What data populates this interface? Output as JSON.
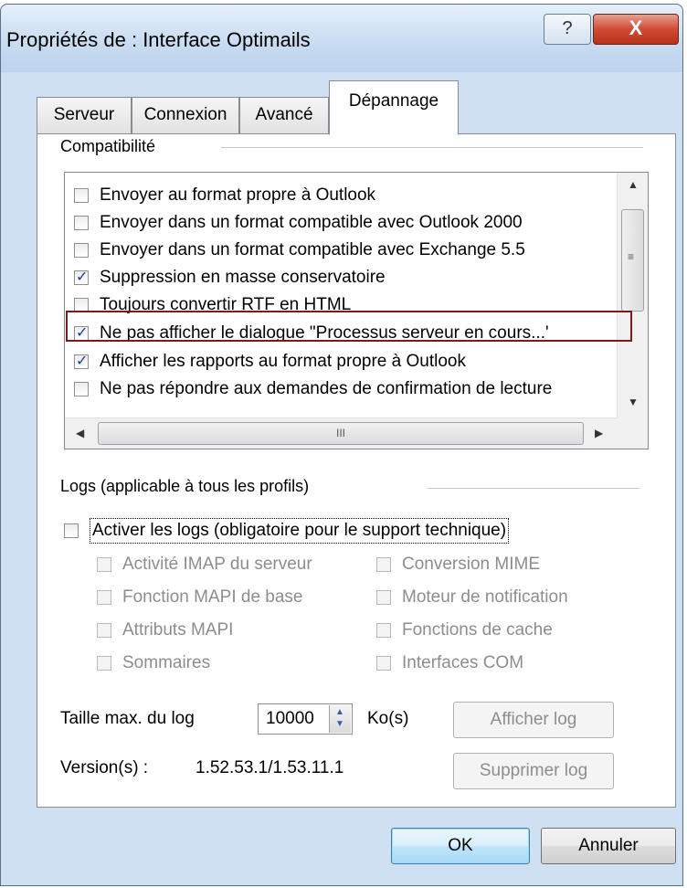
{
  "window": {
    "title": "Propriétés de : Interface Optimails",
    "help_label": "?",
    "close_label": "X"
  },
  "tabs": [
    {
      "label": "Serveur"
    },
    {
      "label": "Connexion"
    },
    {
      "label": "Avancé"
    },
    {
      "label": "Dépannage",
      "active": true
    }
  ],
  "compat": {
    "group_label": "Compatibilité",
    "items": [
      {
        "label": "Envoyer au format propre à Outlook",
        "checked": false
      },
      {
        "label": "Envoyer dans un format compatible avec Outlook 2000",
        "checked": false
      },
      {
        "label": "Envoyer dans un format compatible avec Exchange 5.5",
        "checked": false
      },
      {
        "label": "Suppression en masse conservatoire",
        "checked": true
      },
      {
        "label": "Toujours convertir RTF en HTML",
        "checked": false
      },
      {
        "label": "Ne pas afficher le dialogue \"Processus serveur en cours...'",
        "checked": true,
        "highlighted": true
      },
      {
        "label": "Afficher les rapports au format propre à Outlook",
        "checked": true
      },
      {
        "label": "Ne pas répondre aux demandes de confirmation de lecture",
        "checked": false
      }
    ],
    "hscroll_grip": "III"
  },
  "logs": {
    "group_label": "Logs (applicable à tous les profils)",
    "enable_label": "Activer les logs (obligatoire pour le support technique)",
    "enable_checked": false,
    "options": [
      {
        "label": "Activité IMAP du serveur"
      },
      {
        "label": "Conversion MIME"
      },
      {
        "label": "Fonction MAPI de base"
      },
      {
        "label": "Moteur de notification"
      },
      {
        "label": "Attributs MAPI"
      },
      {
        "label": "Fonctions de cache"
      },
      {
        "label": "Sommaires"
      },
      {
        "label": "Interfaces COM"
      }
    ],
    "max_size_label": "Taille max. du log",
    "max_size_value": "10000",
    "unit_label": "Ko(s)",
    "show_log_button": "Afficher log",
    "version_label": "Version(s) :",
    "version_value": "1.52.53.1/1.53.11.1",
    "delete_log_button": "Supprimer log"
  },
  "footer": {
    "ok_label": "OK",
    "cancel_label": "Annuler"
  },
  "colors": {
    "highlight_border": "#7a1a1a",
    "close_button": "#cf4b33",
    "check_color": "#1c3d8f"
  }
}
